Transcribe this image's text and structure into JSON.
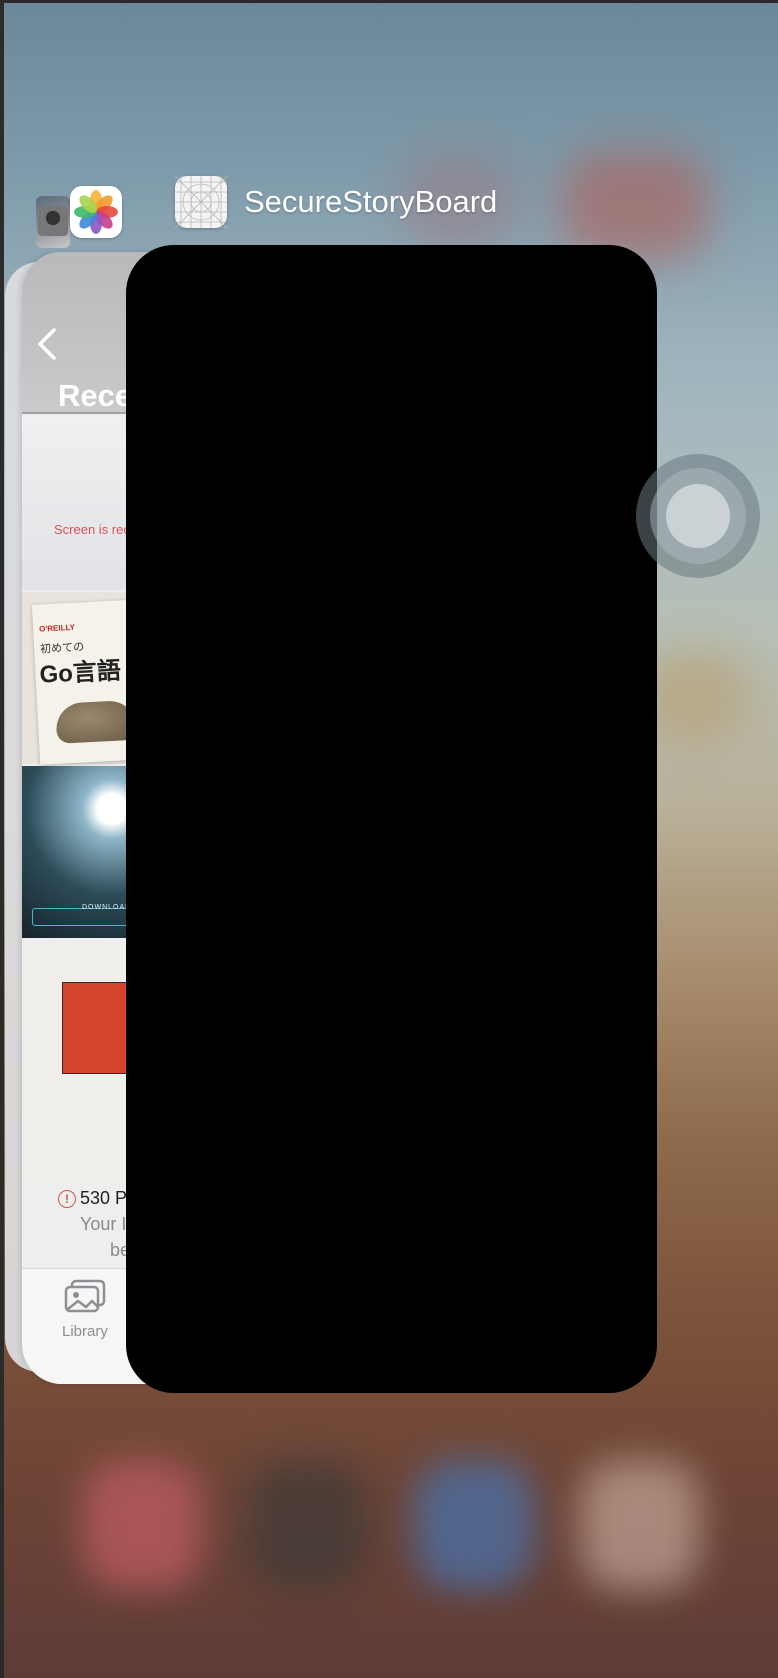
{
  "app_switcher": {
    "active_app_title": "SecureStoryBoard",
    "icons": {
      "photos": "photos-app-icon",
      "storyboard": "storyboard-grid-icon",
      "thumbnail": "album-thumbnail-icon",
      "assistive": "assistive-touch-icon"
    }
  },
  "photos_card": {
    "header": "Rece",
    "record_notice": "Screen is reco",
    "book": {
      "publisher": "O'REILLY",
      "subtitle": "初めての",
      "title": "Go言語"
    },
    "game_label": "DOWNLOADING",
    "warning_text": "530 P",
    "warning_sub1": "Your I",
    "warning_sub2": "be",
    "tab_library": "Library"
  },
  "colors": {
    "black_card": "#000000",
    "warning_red": "#d9534f",
    "red_block": "#d7442e"
  }
}
